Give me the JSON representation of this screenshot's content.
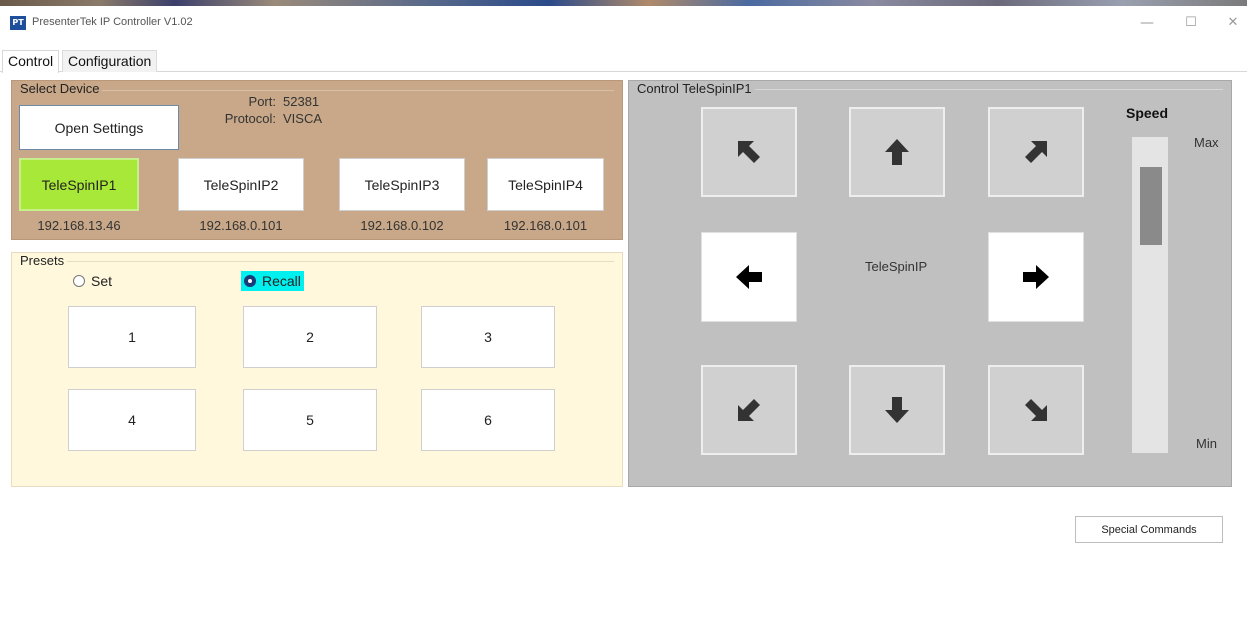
{
  "window": {
    "icon_text": "PT",
    "title": "PresenterTek IP Controller V1.02",
    "minimize": "—",
    "maximize": "☐",
    "close": "✕"
  },
  "tabs": [
    {
      "label": "Control",
      "active": true
    },
    {
      "label": "Configuration",
      "active": false
    }
  ],
  "select_device": {
    "group_label": "Select Device",
    "open_settings_label": "Open Settings",
    "port_label": "Port:",
    "port_value": "52381",
    "protocol_label": "Protocol:",
    "protocol_value": "VISCA",
    "devices": [
      {
        "label": "TeleSpinIP1",
        "ip": "192.168.13.46",
        "selected": true
      },
      {
        "label": "TeleSpinIP2",
        "ip": "192.168.0.101",
        "selected": false
      },
      {
        "label": "TeleSpinIP3",
        "ip": "192.168.0.102",
        "selected": false
      },
      {
        "label": "TeleSpinIP4",
        "ip": "192.168.0.101",
        "selected": false
      }
    ]
  },
  "presets": {
    "group_label": "Presets",
    "set_label": "Set",
    "recall_label": "Recall",
    "mode": "recall",
    "buttons": [
      "1",
      "2",
      "3",
      "4",
      "5",
      "6"
    ]
  },
  "control": {
    "group_label": "Control TeleSpinIP1",
    "center_label": "TeleSpinIP",
    "speed_label": "Speed",
    "speed_max_label": "Max",
    "speed_min_label": "Min",
    "speed_level": 0.9,
    "directions": [
      "up-left",
      "up",
      "up-right",
      "left",
      "right",
      "down-left",
      "down",
      "down-right"
    ]
  },
  "special_commands_label": "Special Commands",
  "colors": {
    "device_panel": "#c8a888",
    "presets_panel": "#fff8dc",
    "control_panel": "#c0c0c0",
    "selected_device": "#a8e838",
    "recall_highlight": "#00f0f0"
  }
}
